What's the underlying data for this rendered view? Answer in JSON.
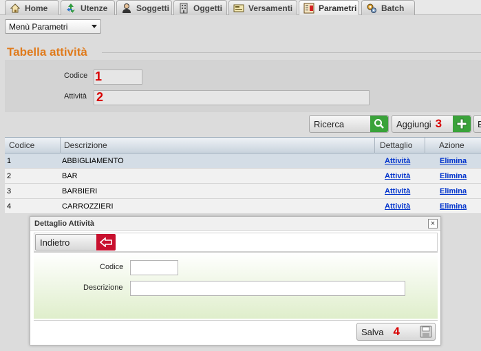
{
  "tabs": [
    {
      "label": "Home",
      "icon": "home-icon"
    },
    {
      "label": "Utenze",
      "icon": "recycle-icon"
    },
    {
      "label": "Soggetti",
      "icon": "person-icon"
    },
    {
      "label": "Oggetti",
      "icon": "building-icon"
    },
    {
      "label": "Versamenti",
      "icon": "payment-icon"
    },
    {
      "label": "Parametri",
      "icon": "parameters-icon"
    },
    {
      "label": "Batch",
      "icon": "gears-icon"
    }
  ],
  "menu": {
    "selected": "Menù Parametri"
  },
  "section_title": "Tabella attività",
  "filter": {
    "codice_label": "Codice",
    "attivita_label": "Attività",
    "marker_codice": "1",
    "marker_attivita": "2"
  },
  "buttons": {
    "ricerca": "Ricerca",
    "aggiungi": "Aggiungi",
    "aggiungi_marker": "3",
    "extra": "E"
  },
  "grid": {
    "headers": [
      "Codice",
      "Descrizione",
      "Dettaglio",
      "Azione"
    ],
    "rows": [
      {
        "codice": "1",
        "descrizione": "ABBIGLIAMENTO",
        "dettaglio": "Attività",
        "azione": "Elimina"
      },
      {
        "codice": "2",
        "descrizione": "BAR",
        "dettaglio": "Attività",
        "azione": "Elimina"
      },
      {
        "codice": "3",
        "descrizione": "BARBIERI",
        "dettaglio": "Attività",
        "azione": "Elimina"
      },
      {
        "codice": "4",
        "descrizione": "CARROZZIERI",
        "dettaglio": "Attività",
        "azione": "Elimina"
      }
    ]
  },
  "dialog": {
    "title": "Dettaglio Attività",
    "close": "×",
    "back_label": "Indietro",
    "codice_label": "Codice",
    "descrizione_label": "Descrizione",
    "save_label": "Salva",
    "save_marker": "4"
  },
  "colors": {
    "accent_orange": "#e07b1c",
    "marker_red": "#d80000",
    "search_green": "#3aa23a",
    "back_red": "#c8102e"
  }
}
